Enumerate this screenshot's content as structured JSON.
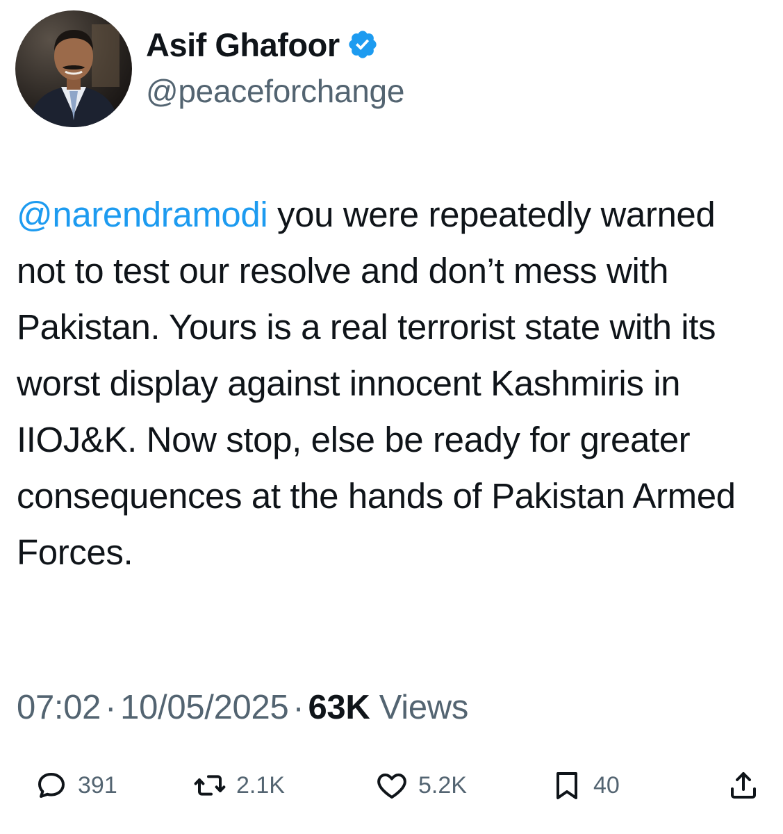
{
  "author": {
    "display_name": "Asif Ghafoor",
    "handle": "@peaceforchange",
    "verified": true
  },
  "tweet": {
    "mention": "@narendramodi",
    "text": " you were repeatedly warned not to test our resolve and don’t mess with Pakistan. Yours is a real terrorist state with its worst display against innocent Kashmiris in IIOJ&K. Now stop, else be ready for greater consequences at the hands of Pakistan Armed Forces."
  },
  "meta": {
    "time": "07:02",
    "separator": "·",
    "date": "10/05/2025",
    "views_count": "63K",
    "views_label": "Views"
  },
  "actions": {
    "replies": "391",
    "reposts": "2.1K",
    "likes": "5.2K",
    "bookmarks": "40"
  },
  "colors": {
    "link": "#1d9bf0",
    "secondary_text": "#536471",
    "primary_text": "#0f1419",
    "verified_badge": "#1d9bf0"
  },
  "icons": [
    "reply-icon",
    "repost-icon",
    "like-icon",
    "bookmark-icon",
    "share-icon",
    "verified-badge-icon"
  ]
}
